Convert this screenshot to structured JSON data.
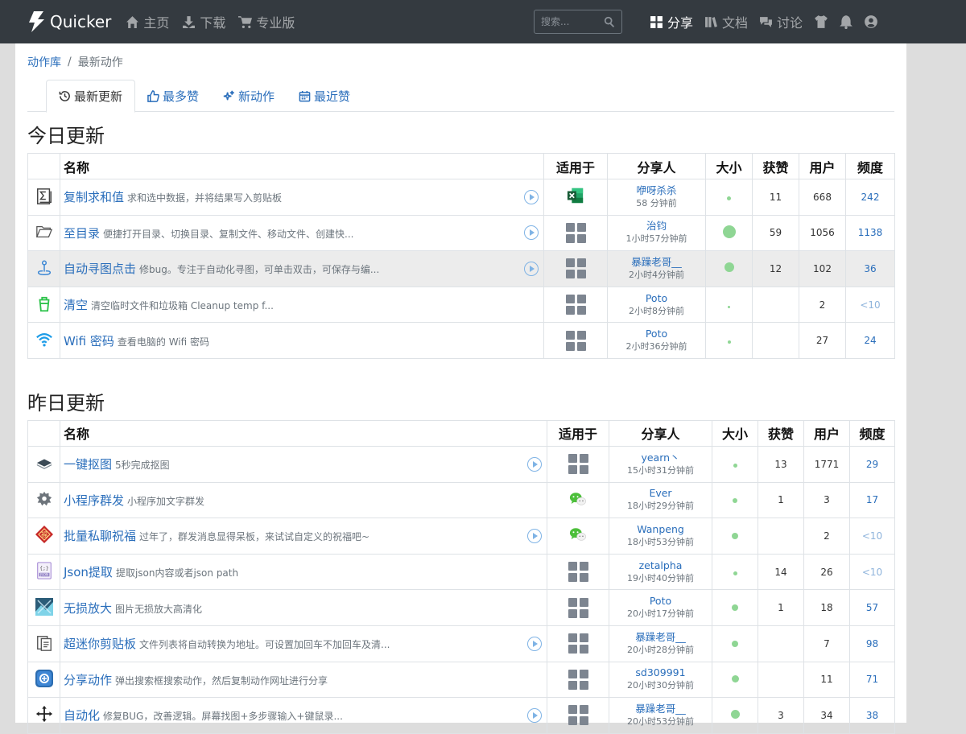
{
  "nav": {
    "brand": "Quicker",
    "links": [
      {
        "label": "主页",
        "icon": "home-icon"
      },
      {
        "label": "下载",
        "icon": "download-icon"
      },
      {
        "label": "专业版",
        "icon": "cart-icon"
      }
    ],
    "search_placeholder": "搜索...",
    "right_links": [
      {
        "label": "分享",
        "icon": "grid-icon",
        "active": true
      },
      {
        "label": "文档",
        "icon": "books-icon"
      },
      {
        "label": "讨论",
        "icon": "comments-icon"
      }
    ]
  },
  "breadcrumb": {
    "root": "动作库",
    "sep": "/",
    "current": "最新动作"
  },
  "tabs": [
    {
      "label": "最新更新",
      "active": true
    },
    {
      "label": "最多赞"
    },
    {
      "label": "新动作"
    },
    {
      "label": "最近赞"
    }
  ],
  "headers": {
    "name": "名称",
    "applies": "适用于",
    "sharer": "分享人",
    "size": "大小",
    "likes": "获赞",
    "users": "用户",
    "freq": "频度"
  },
  "today": {
    "title": "今日更新",
    "rows": [
      {
        "name": "复制求和值",
        "desc": "求和选中数据，并将结果写入剪贴板",
        "play": true,
        "app": "excel",
        "sharer": "咿呀杀杀",
        "time": "58 分钟前",
        "size": 5,
        "likes": "11",
        "users": "668",
        "freq": "242",
        "icon": "sum"
      },
      {
        "name": "至目录",
        "desc": "便捷打开目录、切换目录、复制文件、移动文件、创建快...",
        "play": true,
        "app": "all",
        "sharer": "治钧",
        "time": "1小时57分钟前",
        "size": 16,
        "likes": "59",
        "users": "1056",
        "freq": "1138",
        "icon": "folder"
      },
      {
        "name": "自动寻图点击",
        "desc": "修bug。专注于自动化寻图，可单击双击，可保存与编...",
        "play": true,
        "app": "all",
        "sharer": "暴躁老哥__",
        "time": "2小时4分钟前",
        "size": 12,
        "likes": "12",
        "users": "102",
        "freq": "36",
        "icon": "pin",
        "highlight": true
      },
      {
        "name": "清空",
        "desc": "清空临时文件和垃圾箱 Cleanup temp f...",
        "play": false,
        "app": "all",
        "sharer": "Poto",
        "time": "2小时8分钟前",
        "size": 2,
        "likes": "",
        "users": "2",
        "freq": "<10",
        "icon": "trash"
      },
      {
        "name": "Wifi 密码",
        "desc": "查看电脑的 Wifi 密码",
        "play": false,
        "app": "all",
        "sharer": "Poto",
        "time": "2小时36分钟前",
        "size": 4,
        "likes": "",
        "users": "27",
        "freq": "24",
        "icon": "wifi"
      }
    ]
  },
  "yesterday": {
    "title": "昨日更新",
    "rows": [
      {
        "name": "一键抠图",
        "desc": "5秒完成抠图",
        "play": true,
        "app": "all",
        "sharer": "yearn丶",
        "time": "15小时31分钟前",
        "size": 5,
        "likes": "13",
        "users": "1771",
        "freq": "29",
        "icon": "layers"
      },
      {
        "name": "小程序群发",
        "desc": "小程序加文字群发",
        "play": false,
        "app": "wechat",
        "sharer": "Ever",
        "time": "18小时29分钟前",
        "size": 6,
        "likes": "1",
        "users": "3",
        "freq": "17",
        "icon": "gear"
      },
      {
        "name": "批量私聊祝福",
        "desc": "过年了，群发消息显得呆板，来试试自定义的祝福吧~",
        "play": true,
        "app": "wechat",
        "sharer": "Wanpeng",
        "time": "18小时53分钟前",
        "size": 8,
        "likes": "",
        "users": "2",
        "freq": "<10",
        "icon": "diamond"
      },
      {
        "name": "Json提取",
        "desc": "提取json内容或者json path",
        "play": false,
        "app": "all",
        "sharer": "zetalpha",
        "time": "19小时40分钟前",
        "size": 5,
        "likes": "14",
        "users": "26",
        "freq": "<10",
        "icon": "json"
      },
      {
        "name": "无损放大",
        "desc": "图片无损放大高清化",
        "play": false,
        "app": "all",
        "sharer": "Poto",
        "time": "20小时17分钟前",
        "size": 8,
        "likes": "1",
        "users": "18",
        "freq": "57",
        "icon": "image"
      },
      {
        "name": "超迷你剪贴板",
        "desc": "文件列表将自动转换为地址。可设置加回车不加回车及清...",
        "play": true,
        "app": "all",
        "sharer": "暴躁老哥__",
        "time": "20小时28分钟前",
        "size": 8,
        "likes": "",
        "users": "7",
        "freq": "98",
        "icon": "clipboard"
      },
      {
        "name": "分享动作",
        "desc": "弹出搜索框搜索动作，然后复制动作网址进行分享",
        "play": false,
        "app": "all",
        "sharer": "sd309991",
        "time": "20小时30分钟前",
        "size": 9,
        "likes": "",
        "users": "11",
        "freq": "71",
        "icon": "share"
      },
      {
        "name": "自动化",
        "desc": "修复BUG，改善逻辑。屏幕找图+多步骤输入+键鼠录...",
        "play": true,
        "app": "all",
        "sharer": "暴躁老哥__",
        "time": "20小时53分钟前",
        "size": 11,
        "likes": "3",
        "users": "34",
        "freq": "38",
        "icon": "move"
      }
    ]
  }
}
